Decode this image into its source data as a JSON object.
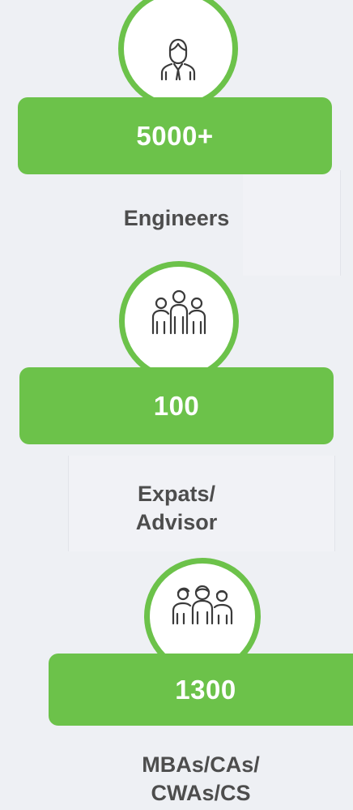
{
  "stats": [
    {
      "icon": "professional-person-icon",
      "value": "5000+",
      "label_lines": [
        "Engineers"
      ]
    },
    {
      "icon": "team-group-icon",
      "value": "100",
      "label_lines": [
        "Expats/",
        "Advisor"
      ]
    },
    {
      "icon": "family-group-icon",
      "value": "1300",
      "label_lines": [
        "MBAs/CAs/",
        "CWAs/CS"
      ]
    }
  ],
  "colors": {
    "accent": "#6cc24a",
    "background": "#eef0f4",
    "label_text": "#4d4d4d",
    "value_text": "#ffffff"
  }
}
